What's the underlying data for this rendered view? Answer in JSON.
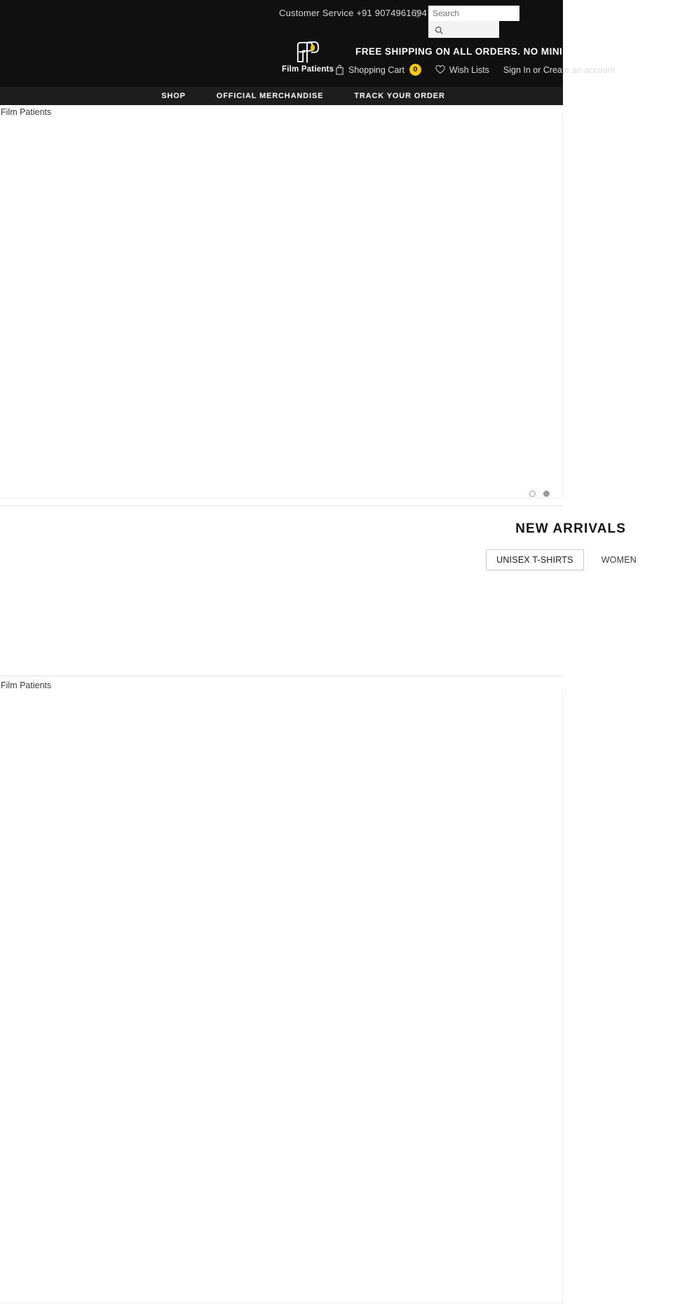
{
  "site": {
    "brand_name": "Film Patients",
    "logo_alt": "Film Patients",
    "accent_color": "#f2c516",
    "header_bg": "#101010",
    "nav_bg": "#1d1d1d"
  },
  "topbar": {
    "customer_service": "Customer Service +91 9074961694",
    "separator_icon": "phone-icon",
    "search": {
      "placeholder": "Search",
      "value": "",
      "icon": "search-icon",
      "button_label": ""
    },
    "promo": "FREE SHIPPING ON ALL ORDERS. NO MINIMUM PURCHASE",
    "cart": {
      "icon": "shopping-bag-icon",
      "label": "Shopping Cart",
      "count": "0"
    },
    "wishlist": {
      "icon": "heart-icon",
      "label": "Wish Lists"
    },
    "auth": {
      "sign_in": "Sign In",
      "or": "or",
      "create_account": "Create an account"
    }
  },
  "nav": {
    "items": [
      {
        "label": "SHOP",
        "name": "nav-item-shop"
      },
      {
        "label": "OFFICIAL MERCHANDISE",
        "name": "nav-item-official-merchandise"
      },
      {
        "label": "TRACK YOUR ORDER",
        "name": "nav-item-track-your-order"
      }
    ]
  },
  "hero": {
    "image_alt": "Film Patients",
    "dots": [
      {
        "active": false
      },
      {
        "active": true
      }
    ]
  },
  "arrivals": {
    "title": "NEW ARRIVALS",
    "tabs": [
      {
        "label": "UNISEX T-SHIRTS",
        "active": true
      },
      {
        "label": "WOMEN",
        "active": false
      }
    ]
  },
  "banner2": {
    "image_alt": "Film Patients"
  }
}
